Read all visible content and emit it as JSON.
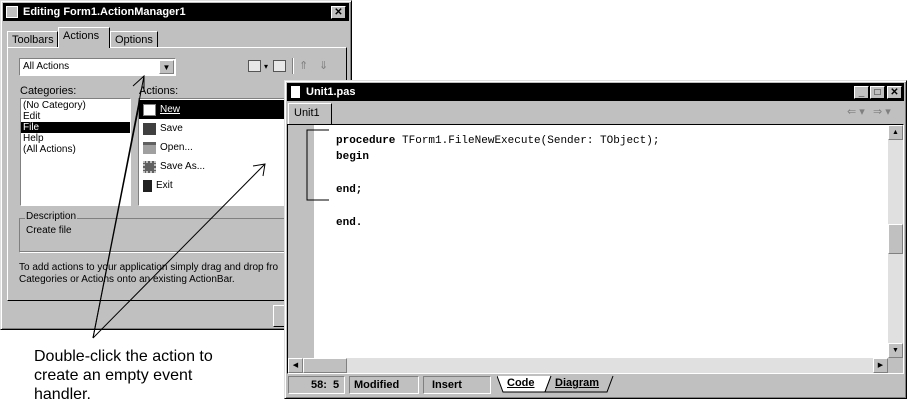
{
  "action_manager": {
    "title": "Editing Form1.ActionManager1",
    "close_glyph": "✕",
    "tabs": [
      "Toolbars",
      "Actions",
      "Options"
    ],
    "filter_value": "All Actions",
    "dropdown_arrow": "▼",
    "categories_label": "Categories:",
    "actions_label": "Actions:",
    "categories": [
      "(No Category)",
      "Edit",
      "File",
      "Help",
      "(All Actions)"
    ],
    "selected_category_index": 2,
    "actions": [
      {
        "label": "New",
        "icon": "new-file-icon"
      },
      {
        "label": "Save",
        "icon": "save-disk-icon"
      },
      {
        "label": "Open...",
        "icon": "open-folder-icon"
      },
      {
        "label": "Save As...",
        "icon": "save-as-icon"
      },
      {
        "label": "Exit",
        "icon": "exit-door-icon"
      }
    ],
    "description_legend": "Description",
    "description_text": "Create file",
    "hint_line1": "To add actions to your application simply drag and drop fro",
    "hint_line2": "Categories or Actions onto an existing ActionBar."
  },
  "editor": {
    "title": "Unit1.pas",
    "tab": "Unit1",
    "nav_back": "⇐ ▾",
    "nav_forward": "⇒ ▾",
    "window_buttons": [
      "_",
      "□",
      "✕"
    ],
    "code_lines": [
      {
        "keyword": "procedure",
        "text": " TForm1.FileNewExecute(Sender: TObject);"
      },
      {
        "keyword": "begin",
        "text": ""
      },
      {
        "keyword": "",
        "text": ""
      },
      {
        "keyword": "end;",
        "text": ""
      },
      {
        "keyword": "",
        "text": ""
      },
      {
        "keyword": "end.",
        "text": ""
      }
    ],
    "status": {
      "position": "58:  5",
      "modified": "Modified",
      "mode": "Insert",
      "tab_code": "Code",
      "tab_diagram": "Diagram"
    }
  },
  "annotation": {
    "line1": "Double-click the action to",
    "line2": "create an empty event",
    "line3": "handler."
  }
}
